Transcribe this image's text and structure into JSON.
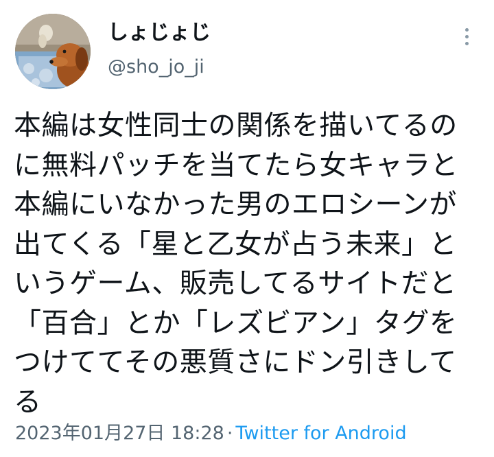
{
  "tweet": {
    "author": {
      "display_name": "しょじょじ",
      "handle": "@sho_jo_ji",
      "avatar": "dachshund-dog-photo"
    },
    "more_icon": "vertical-ellipsis-icon",
    "text": "本編は女性同士の関係を描いてるのに無料パッチを当てたら女キャラと本編にいなかった男のエロシーンが出てくる「星と乙女が占う未来」というゲーム、販売してるサイトだと「百合」とか「レズビアン」タグをつけててその悪質さにドン引きしてる",
    "timestamp": "2023年01月27日 18:28",
    "separator": "·",
    "source": "Twitter for Android",
    "colors": {
      "text": "#0f1419",
      "secondary": "#536471",
      "link": "#1d9bf0"
    }
  }
}
